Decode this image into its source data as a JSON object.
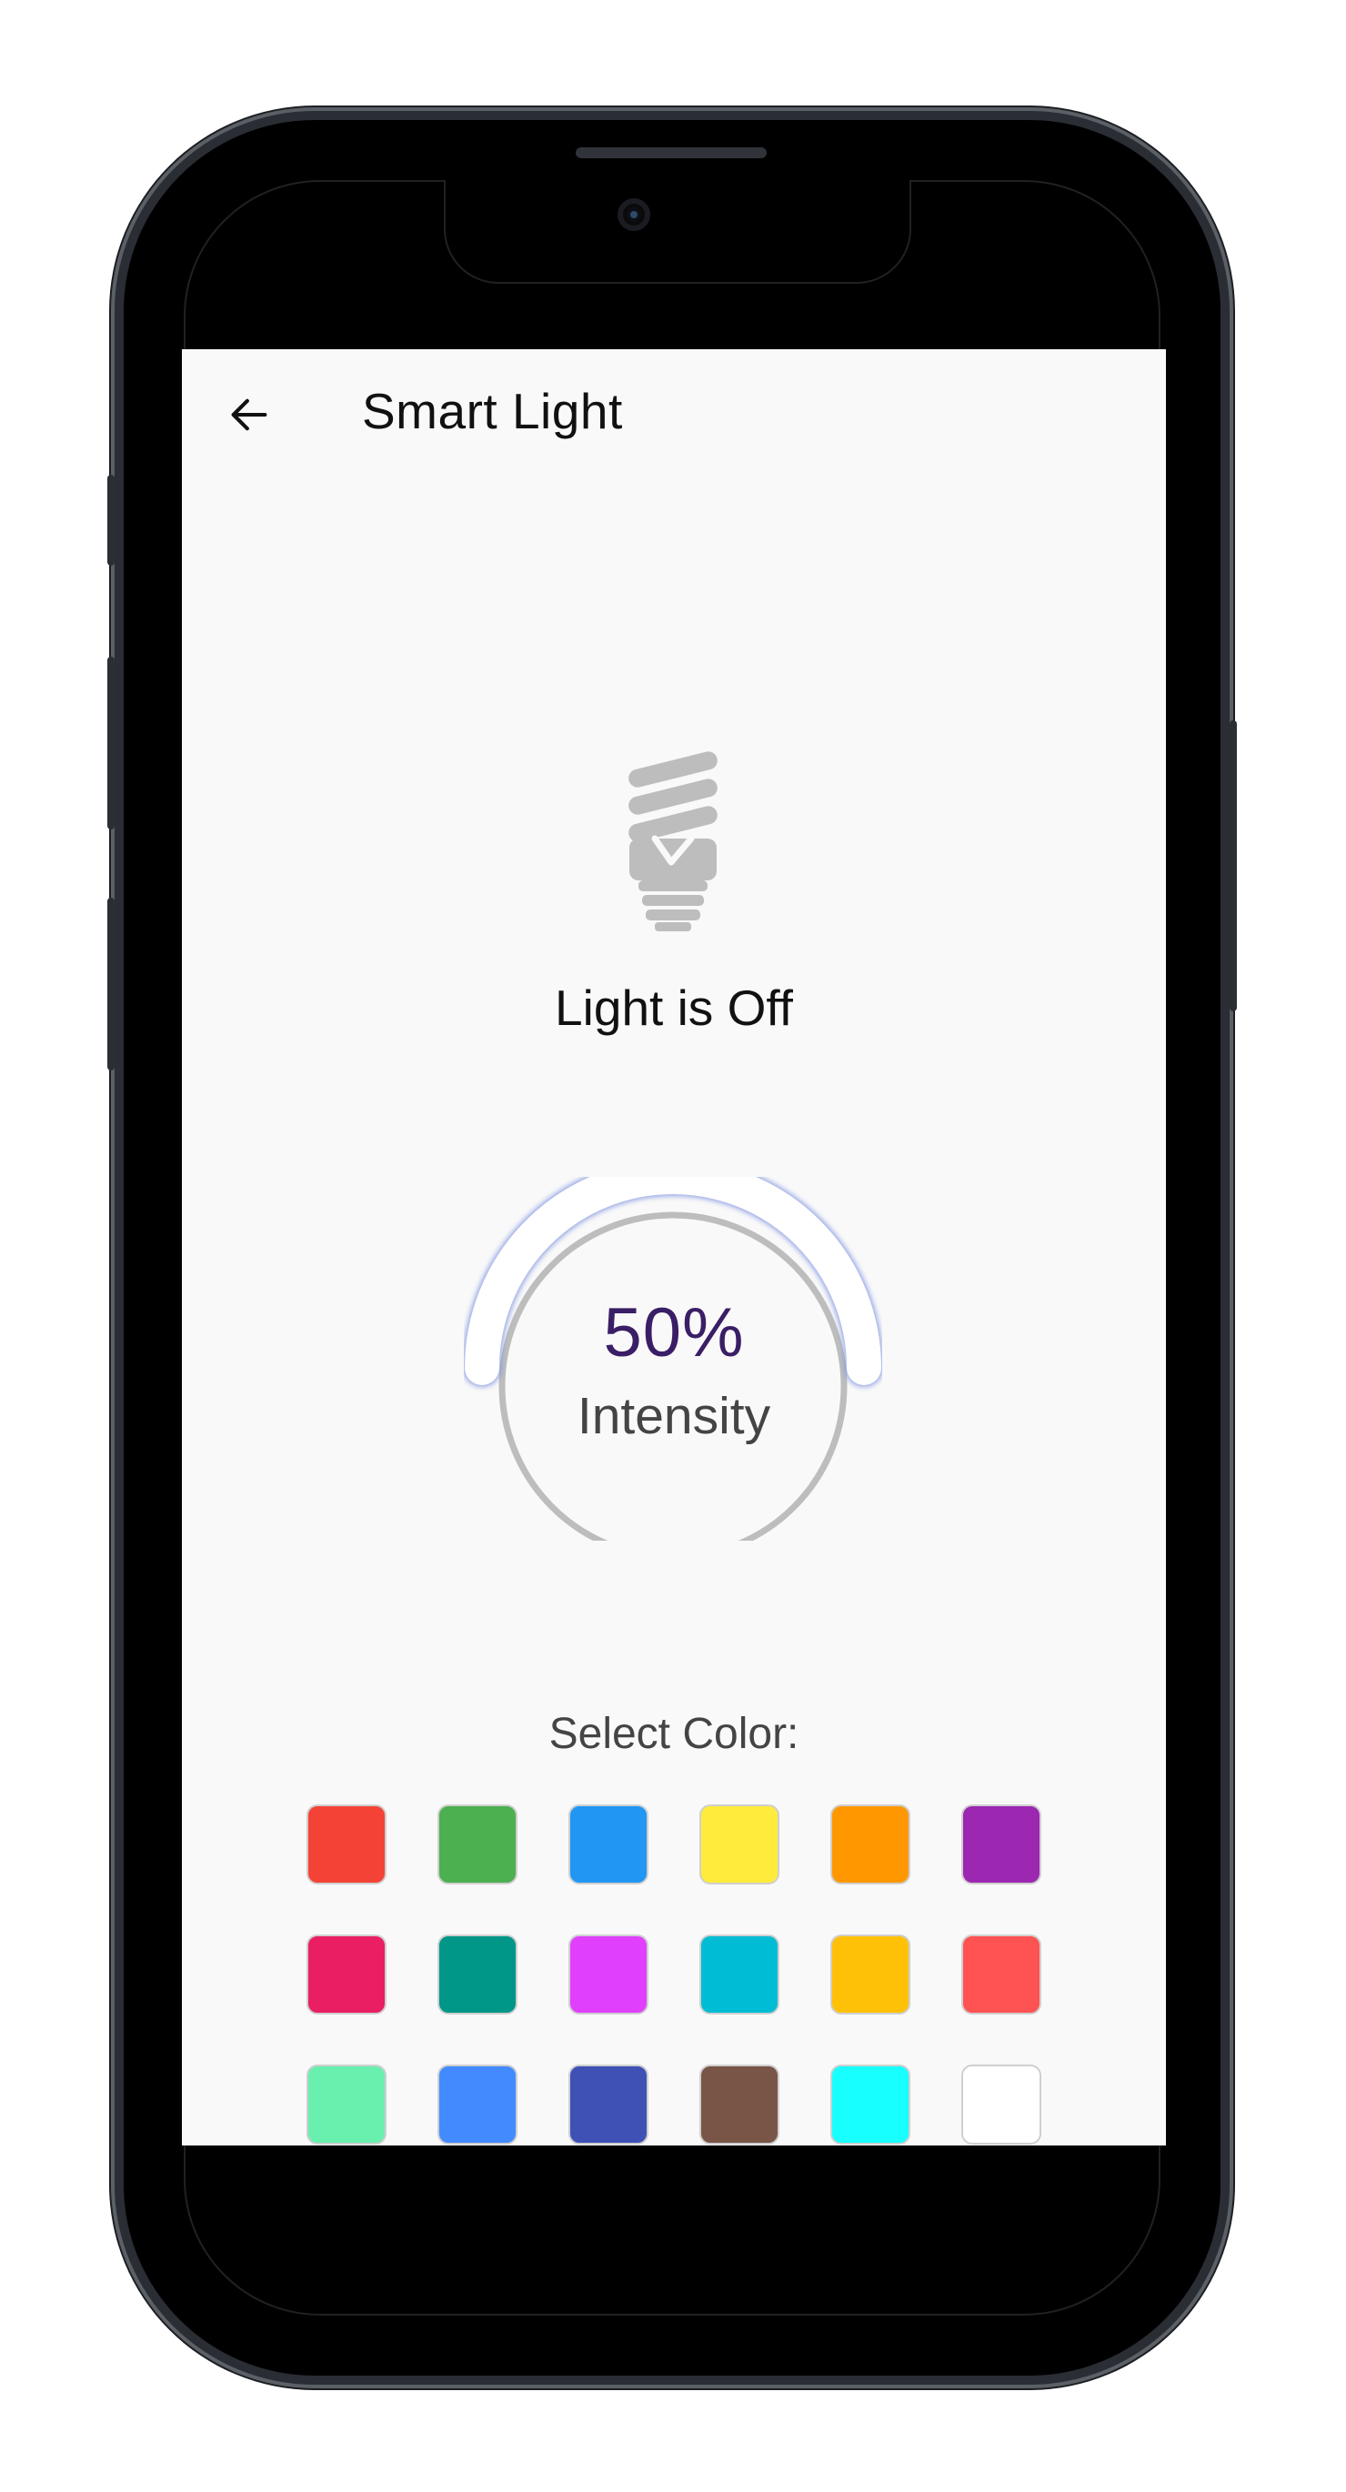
{
  "app_bar": {
    "title": "Smart Light",
    "back_icon": "arrow-left-icon"
  },
  "light": {
    "icon": "cfl-bulb-icon",
    "icon_color": "#bdbdbd",
    "status_text": "Light is Off"
  },
  "intensity": {
    "value_text": "50%",
    "value_fraction": 0.5,
    "label": "Intensity",
    "track_color": "#bdbdbd",
    "glow_color": "#7b8fe0"
  },
  "colors": {
    "label": "Select Color:",
    "swatches": [
      "#f44336",
      "#4caf50",
      "#2196f3",
      "#ffeb3b",
      "#ff9800",
      "#9c27b0",
      "#e91e63",
      "#009688",
      "#e040fb",
      "#00bcd4",
      "#ffc107",
      "#ff5252",
      "#69f0ae",
      "#448aff",
      "#3f51b5",
      "#795548",
      "#18ffff",
      "#ffffff"
    ]
  }
}
